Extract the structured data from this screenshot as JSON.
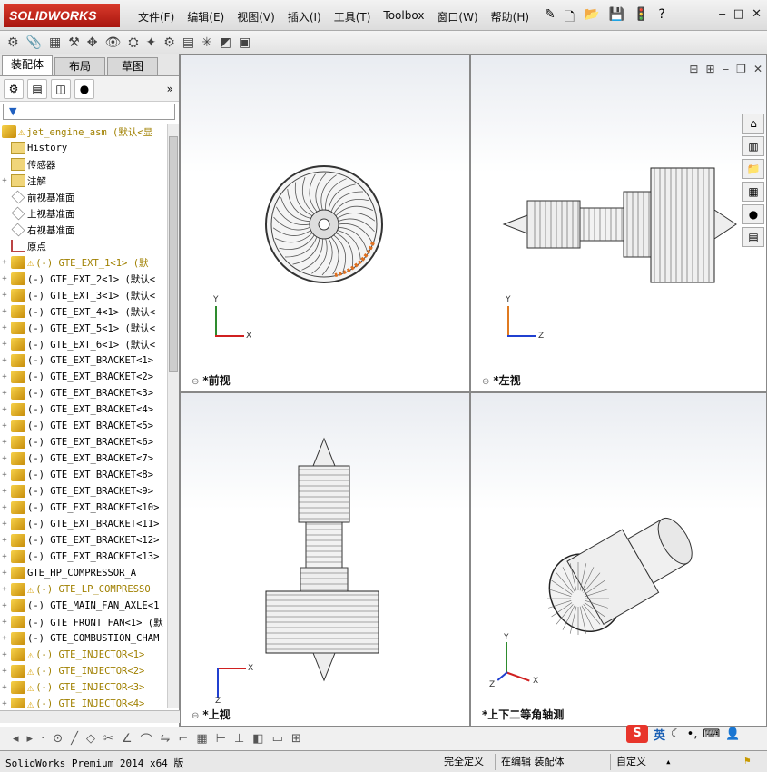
{
  "app": {
    "brand": "SOLIDWORKS"
  },
  "menus": [
    "文件(F)",
    "编辑(E)",
    "视图(V)",
    "插入(I)",
    "工具(T)",
    "Toolbox",
    "窗口(W)",
    "帮助(H)"
  ],
  "window_buttons": [
    "‒",
    "□",
    "✕"
  ],
  "tabs": [
    "装配体",
    "布局",
    "草图"
  ],
  "filter_label": "▼",
  "tree": {
    "root": "jet_engine_asm  (默认<显",
    "items": [
      {
        "label": "History",
        "icon": "folder",
        "warn": false,
        "yellow": false
      },
      {
        "label": "传感器",
        "icon": "folder",
        "warn": false,
        "yellow": false
      },
      {
        "label": "注解",
        "icon": "annotation",
        "warn": false,
        "yellow": false,
        "expand": true
      },
      {
        "label": "前视基准面",
        "icon": "plane",
        "warn": false,
        "yellow": false
      },
      {
        "label": "上视基准面",
        "icon": "plane",
        "warn": false,
        "yellow": false
      },
      {
        "label": "右视基准面",
        "icon": "plane",
        "warn": false,
        "yellow": false
      },
      {
        "label": "原点",
        "icon": "origin",
        "warn": false,
        "yellow": false
      },
      {
        "label": "(-) GTE_EXT_1<1> (默",
        "icon": "part",
        "warn": true,
        "yellow": true,
        "expand": true
      },
      {
        "label": "(-) GTE_EXT_2<1> (默认<",
        "icon": "part",
        "warn": false,
        "yellow": false,
        "expand": true
      },
      {
        "label": "(-) GTE_EXT_3<1> (默认<",
        "icon": "part",
        "warn": false,
        "yellow": false,
        "expand": true
      },
      {
        "label": "(-) GTE_EXT_4<1> (默认<",
        "icon": "part",
        "warn": false,
        "yellow": false,
        "expand": true
      },
      {
        "label": "(-) GTE_EXT_5<1> (默认<",
        "icon": "part",
        "warn": false,
        "yellow": false,
        "expand": true
      },
      {
        "label": "(-) GTE_EXT_6<1> (默认<",
        "icon": "part",
        "warn": false,
        "yellow": false,
        "expand": true
      },
      {
        "label": "(-) GTE_EXT_BRACKET<1>",
        "icon": "part",
        "warn": false,
        "yellow": false,
        "expand": true
      },
      {
        "label": "(-) GTE_EXT_BRACKET<2>",
        "icon": "part",
        "warn": false,
        "yellow": false,
        "expand": true
      },
      {
        "label": "(-) GTE_EXT_BRACKET<3>",
        "icon": "part",
        "warn": false,
        "yellow": false,
        "expand": true
      },
      {
        "label": "(-) GTE_EXT_BRACKET<4>",
        "icon": "part",
        "warn": false,
        "yellow": false,
        "expand": true
      },
      {
        "label": "(-) GTE_EXT_BRACKET<5>",
        "icon": "part",
        "warn": false,
        "yellow": false,
        "expand": true
      },
      {
        "label": "(-) GTE_EXT_BRACKET<6>",
        "icon": "part",
        "warn": false,
        "yellow": false,
        "expand": true
      },
      {
        "label": "(-) GTE_EXT_BRACKET<7>",
        "icon": "part",
        "warn": false,
        "yellow": false,
        "expand": true
      },
      {
        "label": "(-) GTE_EXT_BRACKET<8>",
        "icon": "part",
        "warn": false,
        "yellow": false,
        "expand": true
      },
      {
        "label": "(-) GTE_EXT_BRACKET<9>",
        "icon": "part",
        "warn": false,
        "yellow": false,
        "expand": true
      },
      {
        "label": "(-) GTE_EXT_BRACKET<10>",
        "icon": "part",
        "warn": false,
        "yellow": false,
        "expand": true
      },
      {
        "label": "(-) GTE_EXT_BRACKET<11>",
        "icon": "part",
        "warn": false,
        "yellow": false,
        "expand": true
      },
      {
        "label": "(-) GTE_EXT_BRACKET<12>",
        "icon": "part",
        "warn": false,
        "yellow": false,
        "expand": true
      },
      {
        "label": "(-) GTE_EXT_BRACKET<13>",
        "icon": "part",
        "warn": false,
        "yellow": false,
        "expand": true
      },
      {
        "label": "GTE_HP_COMPRESSOR_A",
        "icon": "part",
        "warn": false,
        "yellow": false,
        "expand": true
      },
      {
        "label": "(-) GTE_LP_COMPRESSO",
        "icon": "part",
        "warn": true,
        "yellow": true,
        "expand": true
      },
      {
        "label": "(-) GTE_MAIN_FAN_AXLE<1",
        "icon": "part",
        "warn": false,
        "yellow": false,
        "expand": true
      },
      {
        "label": "(-) GTE_FRONT_FAN<1> (默",
        "icon": "part",
        "warn": false,
        "yellow": false,
        "expand": true
      },
      {
        "label": "(-) GTE_COMBUSTION_CHAM",
        "icon": "part",
        "warn": false,
        "yellow": false,
        "expand": true
      },
      {
        "label": "(-) GTE_INJECTOR<1>",
        "icon": "part",
        "warn": true,
        "yellow": true,
        "expand": true
      },
      {
        "label": "(-) GTE_INJECTOR<2>",
        "icon": "part",
        "warn": true,
        "yellow": true,
        "expand": true
      },
      {
        "label": "(-) GTE_INJECTOR<3>",
        "icon": "part",
        "warn": true,
        "yellow": true,
        "expand": true
      },
      {
        "label": "(-) GTE_INJECTOR<4>",
        "icon": "part",
        "warn": true,
        "yellow": true,
        "expand": true
      }
    ]
  },
  "viewports": [
    {
      "title": "*前视",
      "axes": [
        "Y",
        "X"
      ]
    },
    {
      "title": "*左视",
      "axes": [
        "Y",
        "Z"
      ]
    },
    {
      "title": "*上视",
      "axes": [
        "X",
        "Z"
      ]
    },
    {
      "title": "*上下二等角轴测",
      "axes": [
        "Y",
        "X",
        "Z"
      ]
    }
  ],
  "status": {
    "app_version": "SolidWorks Premium 2014 x64 版",
    "definition": "完全定义",
    "editing": "在编辑 装配体",
    "units": "自定义"
  },
  "ime": {
    "logo": "S",
    "mode": "英"
  },
  "colors": {
    "brand_red": "#c8231a",
    "warn_yellow": "#d7a000",
    "axis_x": "#d02020",
    "axis_y": "#2e8b2e",
    "axis_z": "#2040d0"
  }
}
